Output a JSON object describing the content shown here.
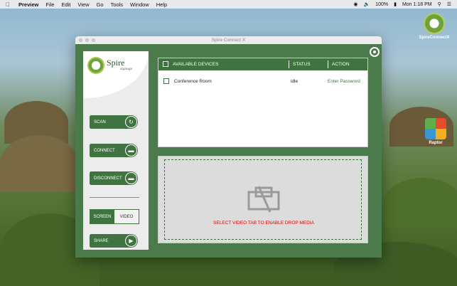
{
  "menubar": {
    "items": [
      "Preview",
      "File",
      "Edit",
      "View",
      "Go",
      "Tools",
      "Window",
      "Help"
    ],
    "battery": "100%",
    "clock": "Mon 1:18 PM"
  },
  "desktop": {
    "icons": [
      {
        "label": "SpireConnectX"
      },
      {
        "label": "Raptor"
      }
    ]
  },
  "window": {
    "title": "Spire Connect X"
  },
  "logo": {
    "name": "Spire",
    "tagline": "signage"
  },
  "sidebar": {
    "scan_label": "SCAN",
    "connect_label": "CONNECT",
    "disconnect_label": "DISCONNECT",
    "screen_tab": "SCREEN",
    "video_tab": "VIDEO",
    "share_label": "SHARE"
  },
  "devices": {
    "headers": {
      "name": "AVAILABLE DEVICES",
      "status": "STATUS",
      "action": "ACTION"
    },
    "rows": [
      {
        "name": "Conference Room",
        "status": "idle",
        "action": "Enter Password"
      }
    ]
  },
  "dropzone": {
    "message": "SELECT VIDEO TAB TO ENABLE DROP MEDIA"
  },
  "colors": {
    "accent": "#3f733f",
    "warning_text": "#e60000"
  }
}
